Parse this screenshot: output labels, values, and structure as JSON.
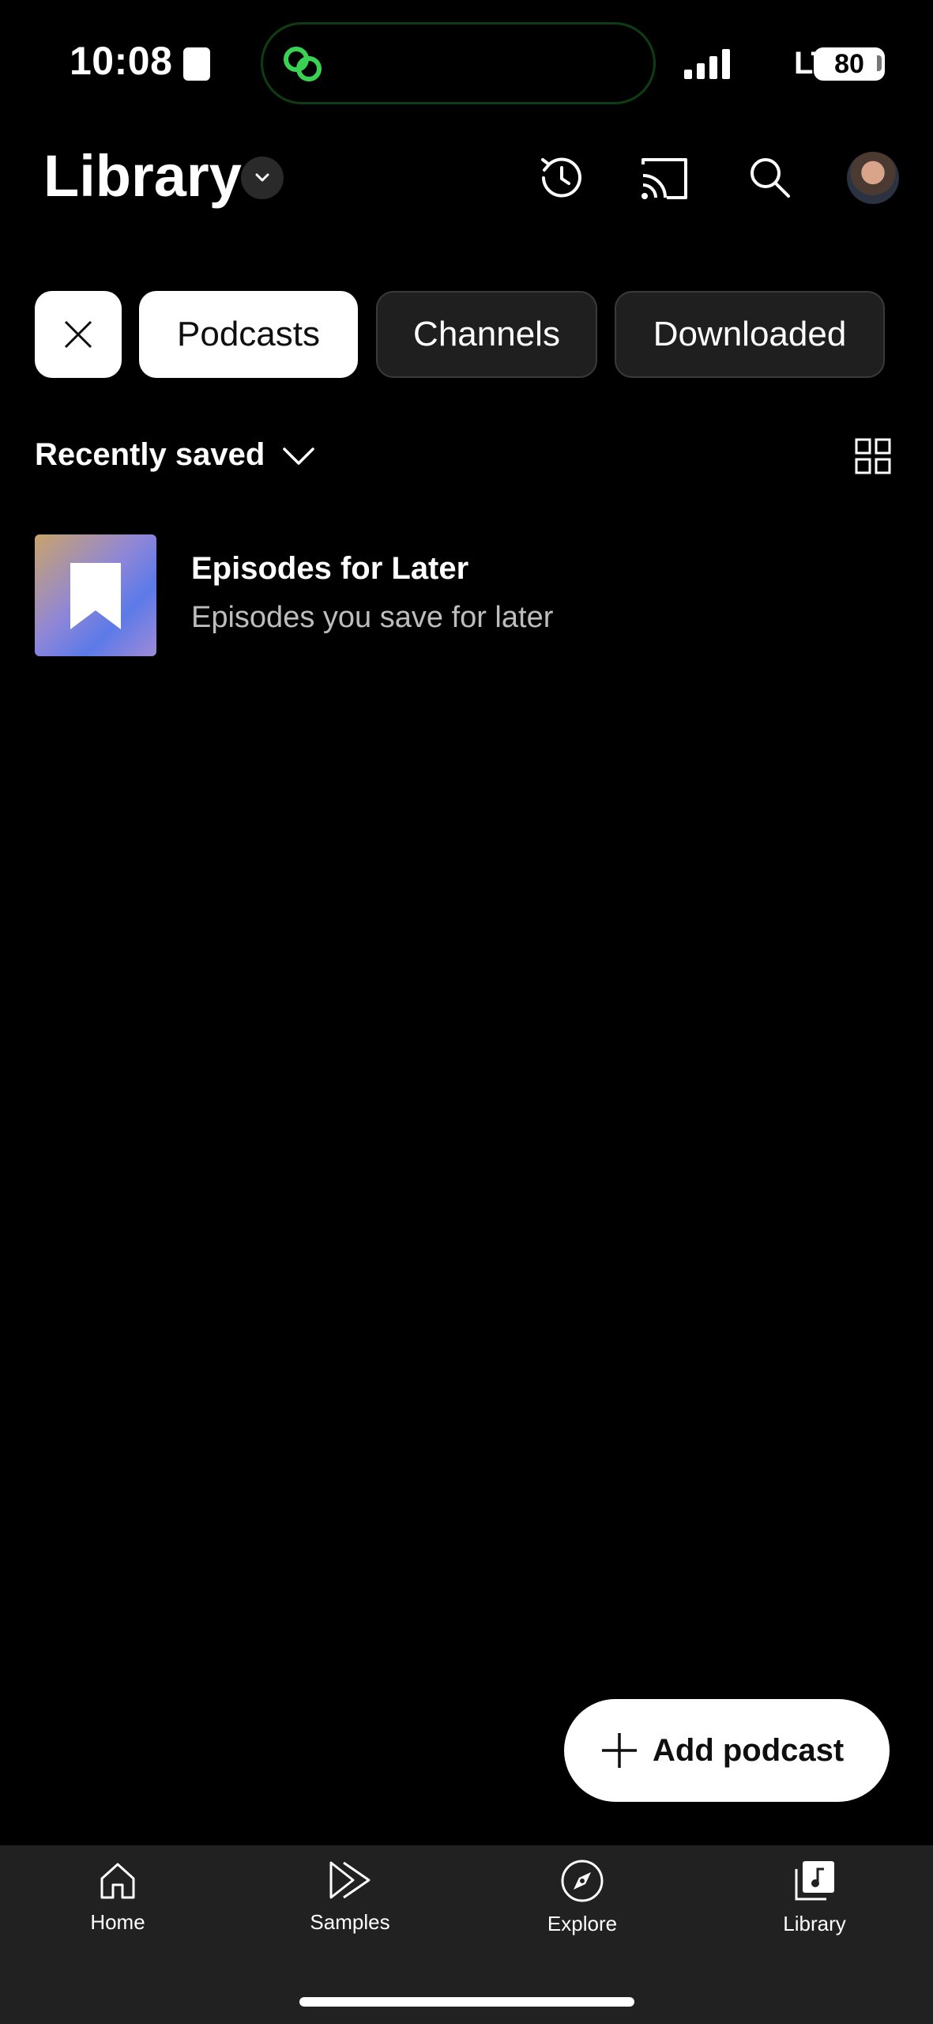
{
  "status_bar": {
    "time": "10:08",
    "network": "LTE",
    "battery": "80"
  },
  "header": {
    "title": "Library"
  },
  "chips": [
    {
      "label": "Podcasts",
      "selected": true
    },
    {
      "label": "Channels",
      "selected": false
    },
    {
      "label": "Downloaded",
      "selected": false
    }
  ],
  "sort": {
    "label": "Recently saved"
  },
  "list": [
    {
      "title": "Episodes for Later",
      "subtitle": "Episodes you save for later",
      "icon": "bookmark-icon"
    }
  ],
  "fab": {
    "label": "Add podcast"
  },
  "bottom_nav": [
    {
      "label": "Home",
      "icon": "home-icon"
    },
    {
      "label": "Samples",
      "icon": "samples-icon"
    },
    {
      "label": "Explore",
      "icon": "compass-icon"
    },
    {
      "label": "Library",
      "icon": "library-icon",
      "active": true
    }
  ],
  "colors": {
    "background": "#000000",
    "nav_background": "#212121",
    "chip_dark": "#1f1f1f",
    "accent_green": "#39d353"
  }
}
